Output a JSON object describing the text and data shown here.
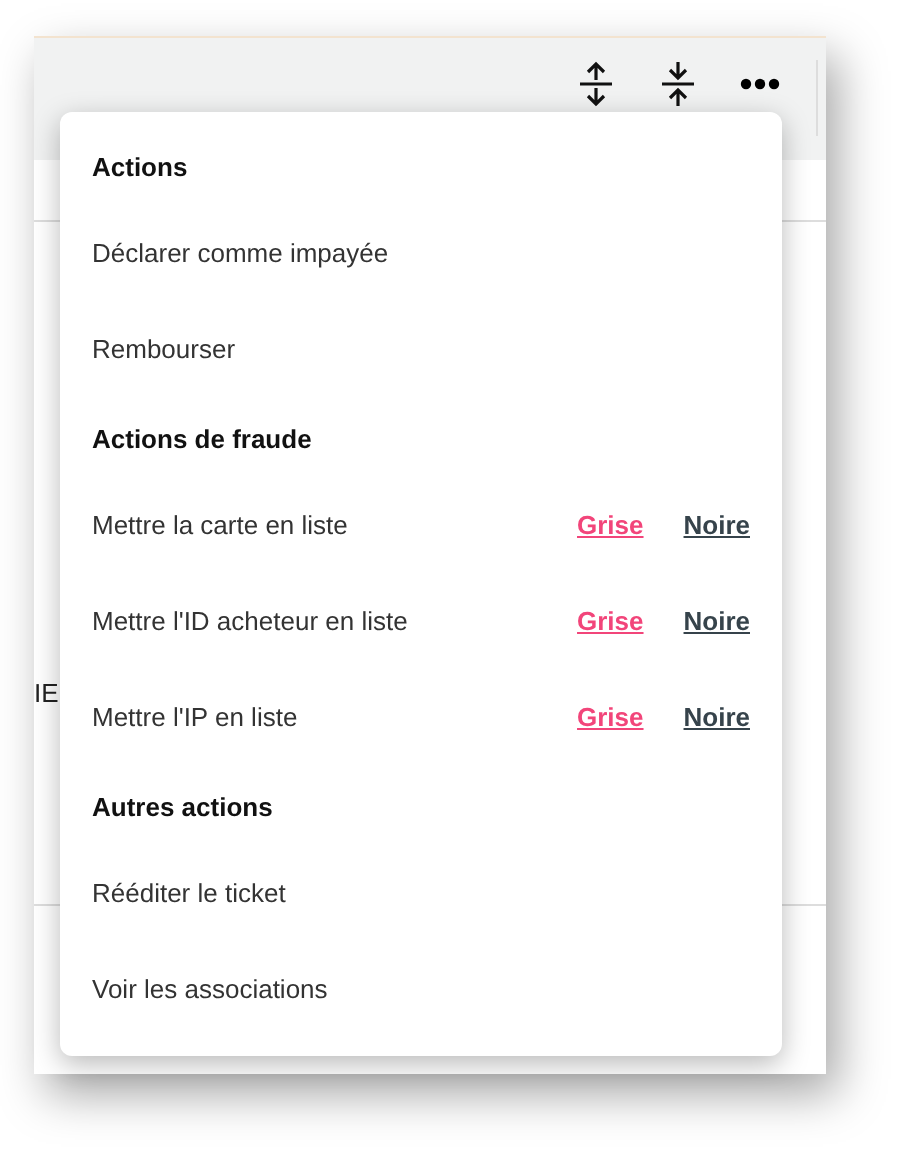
{
  "background": {
    "partial_text": "IE"
  },
  "menu": {
    "sections": [
      {
        "title": "Actions",
        "items": [
          {
            "label": "Déclarer comme impayée"
          },
          {
            "label": "Rembourser"
          }
        ]
      },
      {
        "title": "Actions de fraude",
        "items": [
          {
            "label": "Mettre la carte en liste",
            "links": [
              {
                "label": "Grise",
                "color": "#f2457a"
              },
              {
                "label": "Noire",
                "color": "#36434b"
              }
            ]
          },
          {
            "label": "Mettre l'ID acheteur en liste",
            "links": [
              {
                "label": "Grise",
                "color": "#f2457a"
              },
              {
                "label": "Noire",
                "color": "#36434b"
              }
            ]
          },
          {
            "label": "Mettre l'IP en liste",
            "links": [
              {
                "label": "Grise",
                "color": "#f2457a"
              },
              {
                "label": "Noire",
                "color": "#36434b"
              }
            ]
          }
        ]
      },
      {
        "title": "Autres actions",
        "items": [
          {
            "label": "Rééditer le ticket"
          },
          {
            "label": "Voir les associations"
          }
        ]
      }
    ]
  }
}
